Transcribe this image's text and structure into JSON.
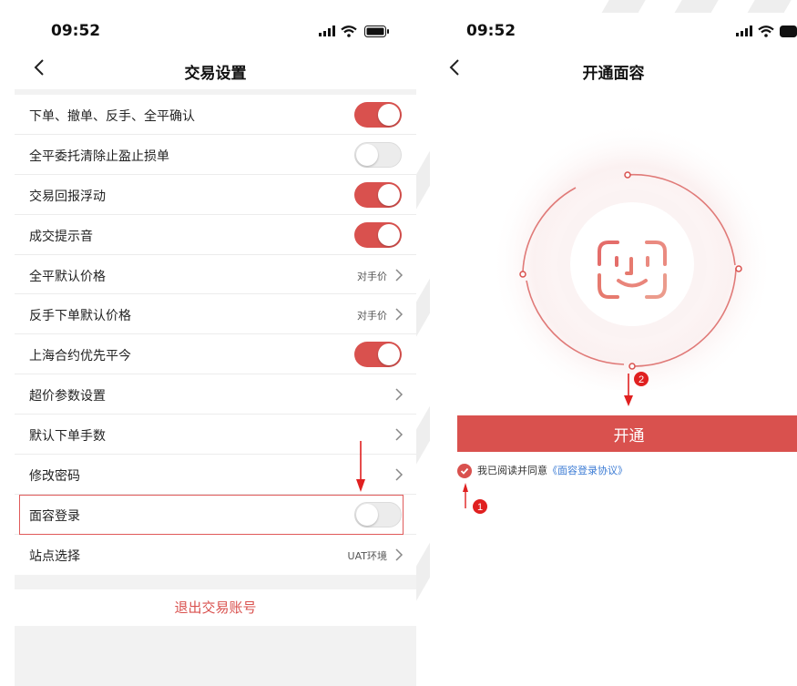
{
  "left_screen": {
    "time": "09:52",
    "title": "交易设置",
    "items": [
      {
        "label": "下单、撤单、反手、全平确认",
        "control": "toggle",
        "on": true
      },
      {
        "label": "全平委托清除止盈止损单",
        "control": "toggle",
        "on": false
      },
      {
        "label": "交易回报浮动",
        "control": "toggle",
        "on": true
      },
      {
        "label": "成交提示音",
        "control": "toggle",
        "on": true
      },
      {
        "label": "全平默认价格",
        "control": "value",
        "value": "对手价"
      },
      {
        "label": "反手下单默认价格",
        "control": "value",
        "value": "对手价"
      },
      {
        "label": "上海合约优先平今",
        "control": "toggle",
        "on": true
      },
      {
        "label": "超价参数设置",
        "control": "chevron"
      },
      {
        "label": "默认下单手数",
        "control": "chevron"
      },
      {
        "label": "修改密码",
        "control": "chevron"
      },
      {
        "label": "面容登录",
        "control": "toggle",
        "on": false,
        "highlighted": true
      },
      {
        "label": "站点选择",
        "control": "value",
        "value": "UAT环境"
      }
    ],
    "logout_label": "退出交易账号"
  },
  "right_screen": {
    "time": "09:52",
    "title": "开通面容",
    "open_button_label": "开通",
    "agree_text": "我已阅读并同意",
    "agree_link": "《面容登录协议》"
  },
  "annotations": {
    "step_1": "1",
    "step_2": "2"
  },
  "colors": {
    "accent": "#d9514e",
    "link": "#3b7bd4",
    "annotation": "#e02020"
  },
  "icons": [
    "back-icon",
    "signal-icon",
    "wifi-icon",
    "battery-icon",
    "chevron-right-icon",
    "face-id-icon",
    "checkbox-checked-icon",
    "arrow-down-icon",
    "arrow-up-icon"
  ]
}
